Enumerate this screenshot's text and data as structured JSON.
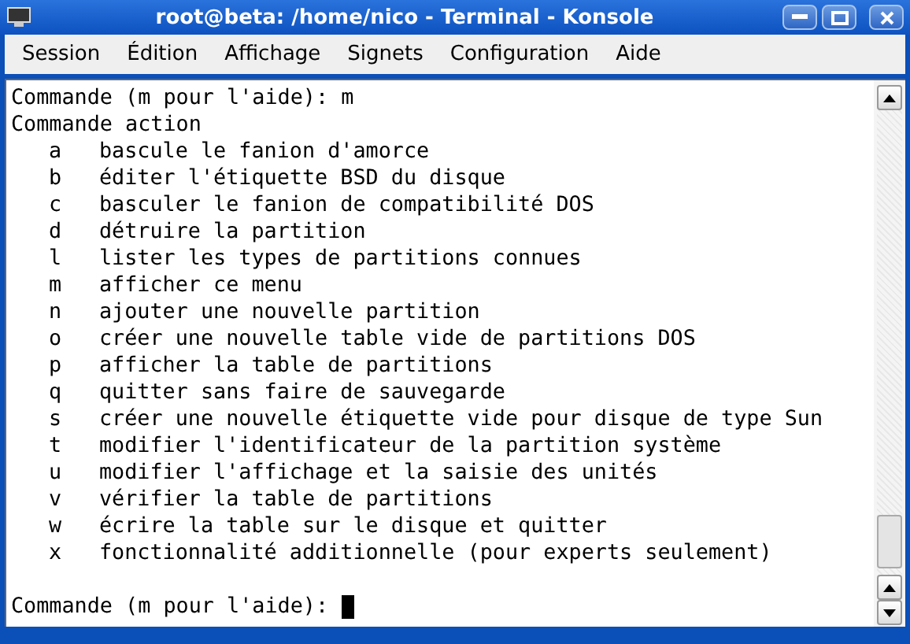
{
  "window": {
    "title": "root@beta: /home/nico - Terminal - Konsole"
  },
  "menu": [
    "Session",
    "Édition",
    "Affichage",
    "Signets",
    "Configuration",
    "Aide"
  ],
  "terminal": {
    "lines": [
      {
        "kind": "text",
        "text": "Commande (m pour l'aide): m"
      },
      {
        "kind": "text",
        "text": "Commande action"
      },
      {
        "kind": "option",
        "key": "a",
        "text": "bascule le fanion d'amorce"
      },
      {
        "kind": "option",
        "key": "b",
        "text": "éditer l'étiquette BSD du disque"
      },
      {
        "kind": "option",
        "key": "c",
        "text": "basculer le fanion de compatibilité DOS"
      },
      {
        "kind": "option",
        "key": "d",
        "text": "détruire la partition"
      },
      {
        "kind": "option",
        "key": "l",
        "text": "lister les types de partitions connues"
      },
      {
        "kind": "option",
        "key": "m",
        "text": "afficher ce menu"
      },
      {
        "kind": "option",
        "key": "n",
        "text": "ajouter une nouvelle partition"
      },
      {
        "kind": "option",
        "key": "o",
        "text": "créer une nouvelle table vide de partitions DOS"
      },
      {
        "kind": "option",
        "key": "p",
        "text": "afficher la table de partitions"
      },
      {
        "kind": "option",
        "key": "q",
        "text": "quitter sans faire de sauvegarde"
      },
      {
        "kind": "option",
        "key": "s",
        "text": "créer une nouvelle étiquette vide pour disque de type Sun"
      },
      {
        "kind": "option",
        "key": "t",
        "text": "modifier l'identificateur de la partition système"
      },
      {
        "kind": "option",
        "key": "u",
        "text": "modifier l'affichage et la saisie des unités"
      },
      {
        "kind": "option",
        "key": "v",
        "text": "vérifier la table de partitions"
      },
      {
        "kind": "option",
        "key": "w",
        "text": "écrire la table sur le disque et quitter"
      },
      {
        "kind": "option",
        "key": "x",
        "text": "fonctionnalité additionnelle (pour experts seulement)"
      },
      {
        "kind": "blank"
      },
      {
        "kind": "prompt",
        "text": "Commande (m pour l'aide):",
        "cursor": true
      }
    ]
  }
}
